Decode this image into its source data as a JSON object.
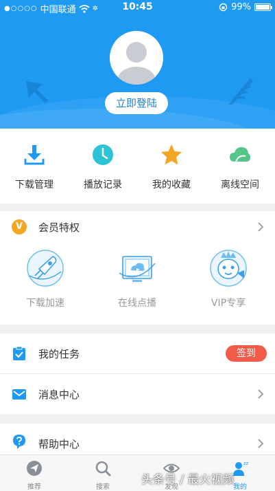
{
  "status_bar": {
    "carrier": "中国联通",
    "time": "10:45",
    "battery": "99%",
    "battery_level": 0.99
  },
  "profile": {
    "login_label": "立即登陆"
  },
  "quick_actions": [
    {
      "label": "下载管理",
      "icon": "download-icon",
      "color": "#1f9af3"
    },
    {
      "label": "播放记录",
      "icon": "clock-icon",
      "color": "#2cc3d6"
    },
    {
      "label": "我的收藏",
      "icon": "star-icon",
      "color": "#f5a623"
    },
    {
      "label": "离线空间",
      "icon": "cloud-icon",
      "color": "#55c58a"
    }
  ],
  "member": {
    "badge": "V",
    "title": "会员特权",
    "perks": [
      {
        "label": "下载加速",
        "icon": "rocket-icon"
      },
      {
        "label": "在线点播",
        "icon": "tv-icon"
      },
      {
        "label": "VIP专享",
        "icon": "mascot-icon"
      }
    ]
  },
  "list": {
    "tasks": {
      "label": "我的任务",
      "action": "签到"
    },
    "messages": {
      "label": "消息中心"
    },
    "help": {
      "label": "帮助中心"
    }
  },
  "tabs": [
    {
      "label": "推荐",
      "icon": "paper-plane-icon",
      "active": false
    },
    {
      "label": "搜索",
      "icon": "search-icon",
      "active": false
    },
    {
      "label": "发现",
      "icon": "eye-icon",
      "active": false
    },
    {
      "label": "我的",
      "icon": "user-icon",
      "active": true
    }
  ],
  "watermark": "头条号 / 最火视频",
  "colors": {
    "primary": "#1f9af3",
    "accent_red": "#f25a4a",
    "vip_orange": "#f5a623"
  }
}
